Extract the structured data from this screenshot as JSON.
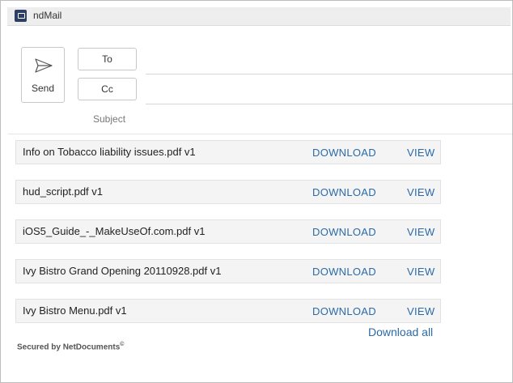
{
  "window": {
    "title": "ndMail",
    "icon": "ndmail-app-icon"
  },
  "compose": {
    "send_label": "Send",
    "send_icon": "send-arrow-icon",
    "to_label": "To",
    "to_value": "",
    "cc_label": "Cc",
    "cc_value": "",
    "subject_label": "Subject"
  },
  "attachments": [
    {
      "name": "Info on Tobacco liability issues.pdf v1",
      "download": "DOWNLOAD",
      "view": "VIEW"
    },
    {
      "name": "hud_script.pdf v1",
      "download": "DOWNLOAD",
      "view": "VIEW"
    },
    {
      "name": "iOS5_Guide_-_MakeUseOf.com.pdf v1",
      "download": "DOWNLOAD",
      "view": "VIEW"
    },
    {
      "name": "Ivy Bistro Grand Opening 20110928.pdf v1",
      "download": "DOWNLOAD",
      "view": "VIEW"
    },
    {
      "name": "Ivy Bistro Menu.pdf v1",
      "download": "DOWNLOAD",
      "view": "VIEW"
    }
  ],
  "footer": {
    "download_all": "Download all",
    "secured_text": "Secured by NetDocuments",
    "registered_mark": "©"
  },
  "colors": {
    "link": "#2b6aa8",
    "row_bg": "#f4f4f4",
    "app_icon": "#2e3f66"
  }
}
